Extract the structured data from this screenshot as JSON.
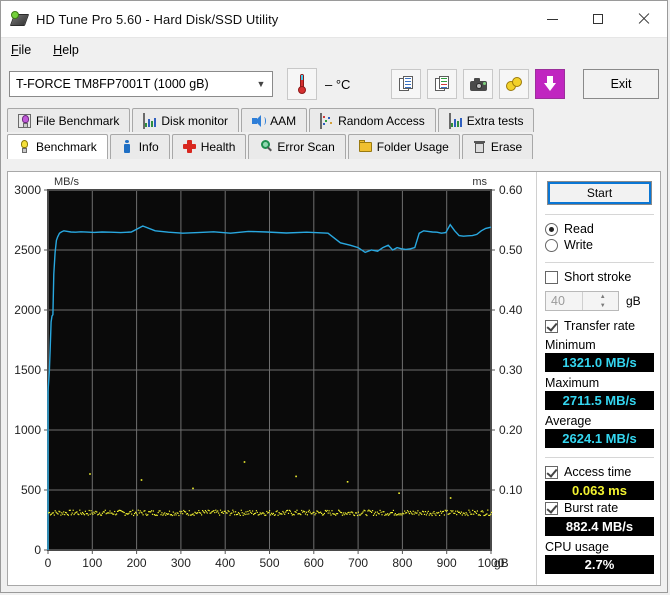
{
  "window": {
    "title": "HD Tune Pro 5.60 - Hard Disk/SSD Utility",
    "app_icon": "hdd-icon",
    "minimize": "minimize-icon",
    "maximize": "maximize-icon",
    "close": "close-icon"
  },
  "menu": {
    "items": [
      {
        "label": "File",
        "mnemonic": "F"
      },
      {
        "label": "Help",
        "mnemonic": "H"
      }
    ]
  },
  "toolbar": {
    "drive": "T-FORCE TM8FP7001T (1000 gB)",
    "dropdown_icon": "chevron-down-icon",
    "temperature": "– °C",
    "thermometer_icon": "thermometer-icon",
    "buttons": [
      {
        "name": "copy-text-icon",
        "label": ""
      },
      {
        "name": "copy-image-icon",
        "label": ""
      },
      {
        "name": "screenshot-camera-icon",
        "label": ""
      },
      {
        "name": "coins-icon",
        "label": ""
      },
      {
        "name": "save-download-icon",
        "label": ""
      }
    ],
    "exit_label": "Exit"
  },
  "tabs": {
    "row1": [
      {
        "label": "File Benchmark",
        "icon": "bulb-violet-icon",
        "active": false
      },
      {
        "label": "Disk monitor",
        "icon": "bar-chart-icon",
        "active": false
      },
      {
        "label": "AAM",
        "icon": "speaker-icon",
        "active": false
      },
      {
        "label": "Random Access",
        "icon": "random-dots-icon",
        "active": false
      },
      {
        "label": "Extra tests",
        "icon": "extra-chart-icon",
        "active": false
      }
    ],
    "row2": [
      {
        "label": "Benchmark",
        "icon": "bulb-icon",
        "active": true
      },
      {
        "label": "Info",
        "icon": "info-icon",
        "active": false
      },
      {
        "label": "Health",
        "icon": "red-cross-icon",
        "active": false
      },
      {
        "label": "Error Scan",
        "icon": "magnifier-icon",
        "active": false
      },
      {
        "label": "Folder Usage",
        "icon": "folder-icon",
        "active": false
      },
      {
        "label": "Erase",
        "icon": "trash-icon",
        "active": false
      }
    ]
  },
  "panel": {
    "start_label": "Start",
    "mode": {
      "read_label": "Read",
      "write_label": "Write",
      "selected": "Read"
    },
    "short_stroke": {
      "label": "Short stroke",
      "checked": false,
      "value": "40",
      "unit": "gB"
    },
    "transfer_rate": {
      "label": "Transfer rate",
      "checked": true
    },
    "minimum": {
      "label": "Minimum",
      "value": "1321.0 MB/s",
      "color": "#34d6f0"
    },
    "maximum": {
      "label": "Maximum",
      "value": "2711.5 MB/s",
      "color": "#34d6f0"
    },
    "average": {
      "label": "Average",
      "value": "2624.1 MB/s",
      "color": "#34d6f0"
    },
    "access_time": {
      "label": "Access time",
      "checked": true,
      "value": "0.063 ms",
      "color": "#f2f230"
    },
    "burst_rate": {
      "label": "Burst rate",
      "checked": true,
      "value": "882.4 MB/s",
      "color": "#ffffff"
    },
    "cpu_usage": {
      "label": "CPU usage",
      "value": "2.7%",
      "color": "#ffffff"
    }
  },
  "chart_data": {
    "type": "line",
    "title": "",
    "xlabel": "gB",
    "ylabel": "MB/s",
    "y2label": "ms",
    "xlim": [
      0,
      1000
    ],
    "ylim": [
      0,
      3000
    ],
    "y2lim": [
      0,
      0.6
    ],
    "grid": true,
    "legend": "none",
    "background": "#0a0a0a",
    "gridcolor": "#6e6e6e",
    "xticks": [
      0,
      100,
      200,
      300,
      400,
      500,
      600,
      700,
      800,
      900,
      1000
    ],
    "xticklabels": [
      "0",
      "100",
      "200",
      "300",
      "400",
      "500",
      "600",
      "700",
      "800",
      "900",
      "1000"
    ],
    "yticks": [
      0,
      500,
      1000,
      1500,
      2000,
      2500,
      3000
    ],
    "yticklabels": [
      "0",
      "500",
      "1000",
      "1500",
      "2000",
      "2500",
      "3000"
    ],
    "y2ticks": [
      0.1,
      0.2,
      0.3,
      0.4,
      0.5,
      0.6
    ],
    "y2ticklabels": [
      "0.10",
      "0.20",
      "0.30",
      "0.40",
      "0.50",
      "0.60"
    ],
    "series": [
      {
        "name": "Transfer rate",
        "axis": "left",
        "type": "line",
        "color": "#29a8e0",
        "x": [
          0,
          3,
          5,
          7,
          9,
          11,
          13,
          16,
          19,
          22,
          26,
          30,
          36,
          44,
          52,
          62,
          74,
          88,
          104,
          122,
          142,
          164,
          188,
          214,
          242,
          272,
          304,
          338,
          374,
          412,
          452,
          494,
          538,
          584,
          632,
          660,
          682,
          700,
          716,
          730,
          744,
          756,
          768,
          778,
          788,
          798,
          808,
          818,
          828,
          838,
          848,
          858,
          868,
          878,
          888,
          898,
          908,
          918,
          928,
          938,
          948,
          958,
          968,
          978,
          988,
          1000
        ],
        "y": [
          1321,
          1480,
          1680,
          1900,
          1950,
          1960,
          2300,
          2480,
          2580,
          2610,
          2640,
          2650,
          2660,
          2655,
          2650,
          2648,
          2652,
          2649,
          2647,
          2650,
          2648,
          2645,
          2650,
          2700,
          2660,
          2648,
          2640,
          2645,
          2652,
          2640,
          2655,
          2650,
          2642,
          2648,
          2640,
          2560,
          2540,
          2520,
          2480,
          2500,
          2490,
          2520,
          2540,
          2500,
          2520,
          2510,
          2505,
          2510,
          2520,
          2640,
          2660,
          2655,
          2650,
          2648,
          2640,
          2645,
          2711,
          2660,
          2620,
          2615,
          2618,
          2620,
          2630,
          2660,
          2680,
          2690
        ]
      },
      {
        "name": "Access time",
        "axis": "right",
        "type": "scatter",
        "color": "#f2f230",
        "baseline_ms": 0.063,
        "outliers_ms": [
          0.128,
          0.118,
          0.104,
          0.148,
          0.124,
          0.115,
          0.096,
          0.088
        ]
      }
    ]
  }
}
